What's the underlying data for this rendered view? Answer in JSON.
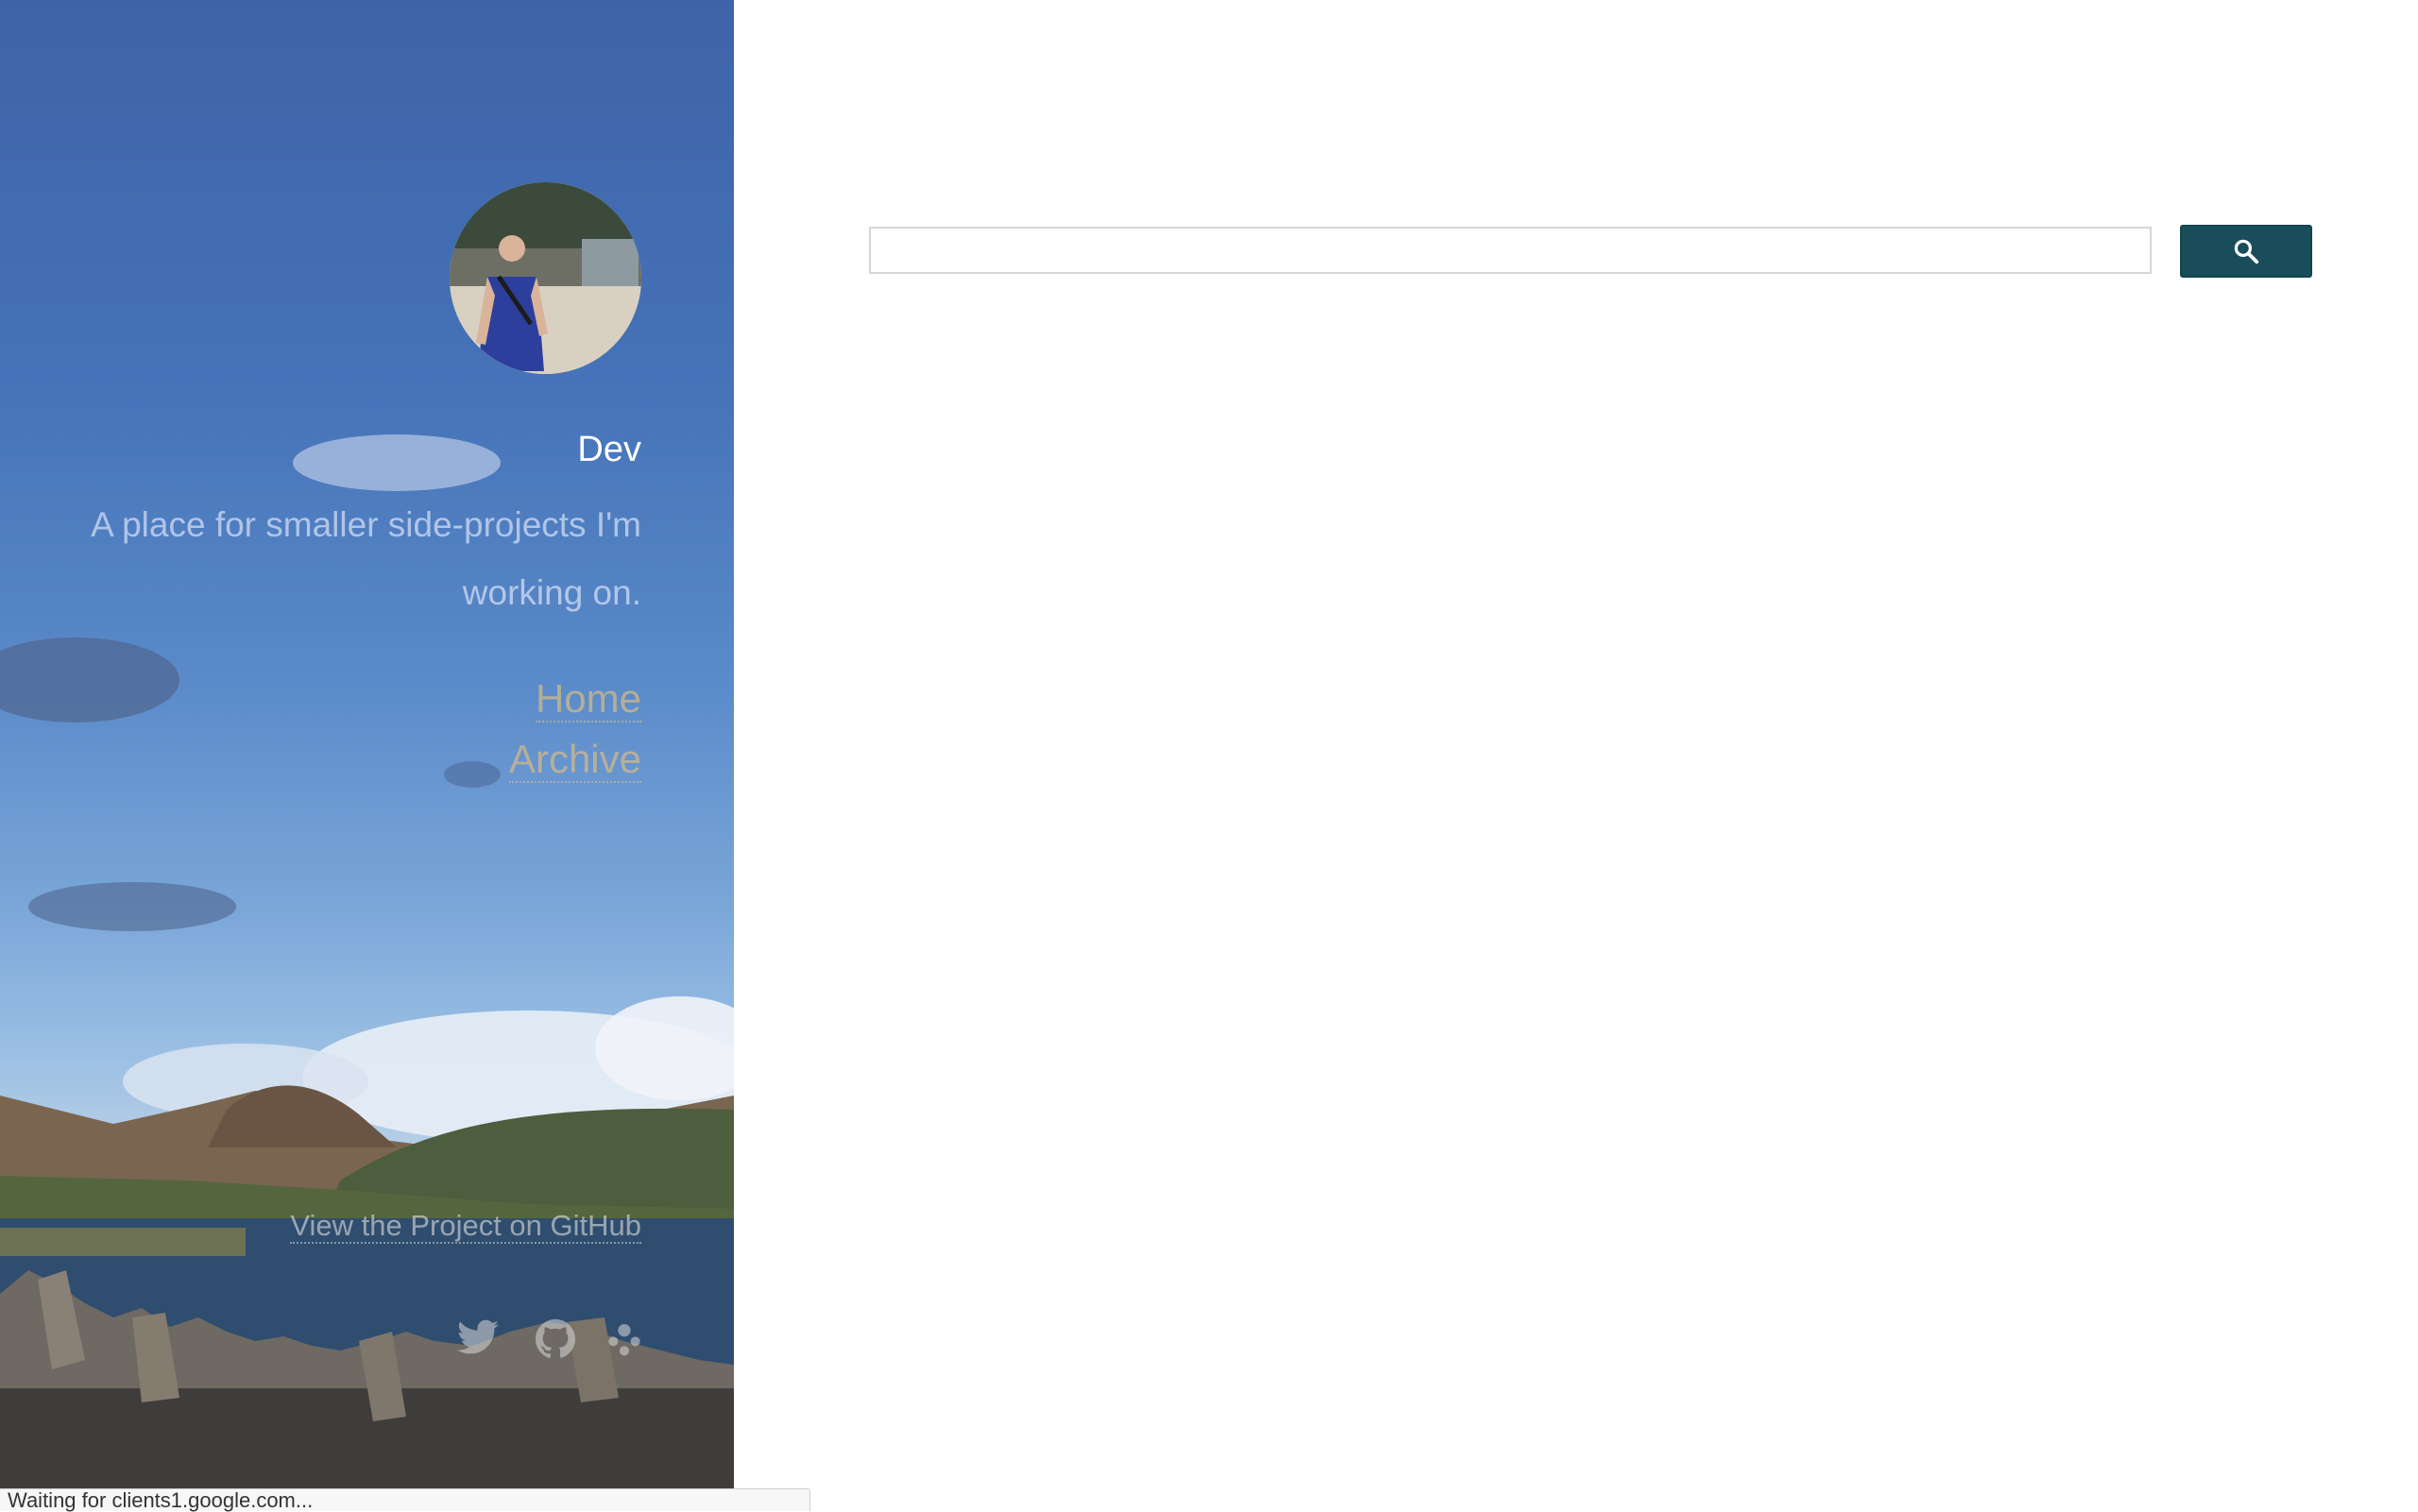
{
  "sidebar": {
    "site_name": "Dev",
    "description": "A place for smaller side-projects I'm working on.",
    "nav": [
      {
        "label": "Home"
      },
      {
        "label": "Archive"
      }
    ],
    "github_link": "View the Project on GitHub",
    "social_icons": [
      "twitter-icon",
      "github-icon",
      "octopus-icon"
    ]
  },
  "search": {
    "value": "",
    "placeholder": "",
    "button_icon": "search-icon"
  },
  "status_bar": {
    "text": "Waiting for clients1.google.com..."
  },
  "colors": {
    "search_button": "#194d59",
    "sidebar_sky": "#4572b8",
    "nav_link": "#cdb78c"
  }
}
